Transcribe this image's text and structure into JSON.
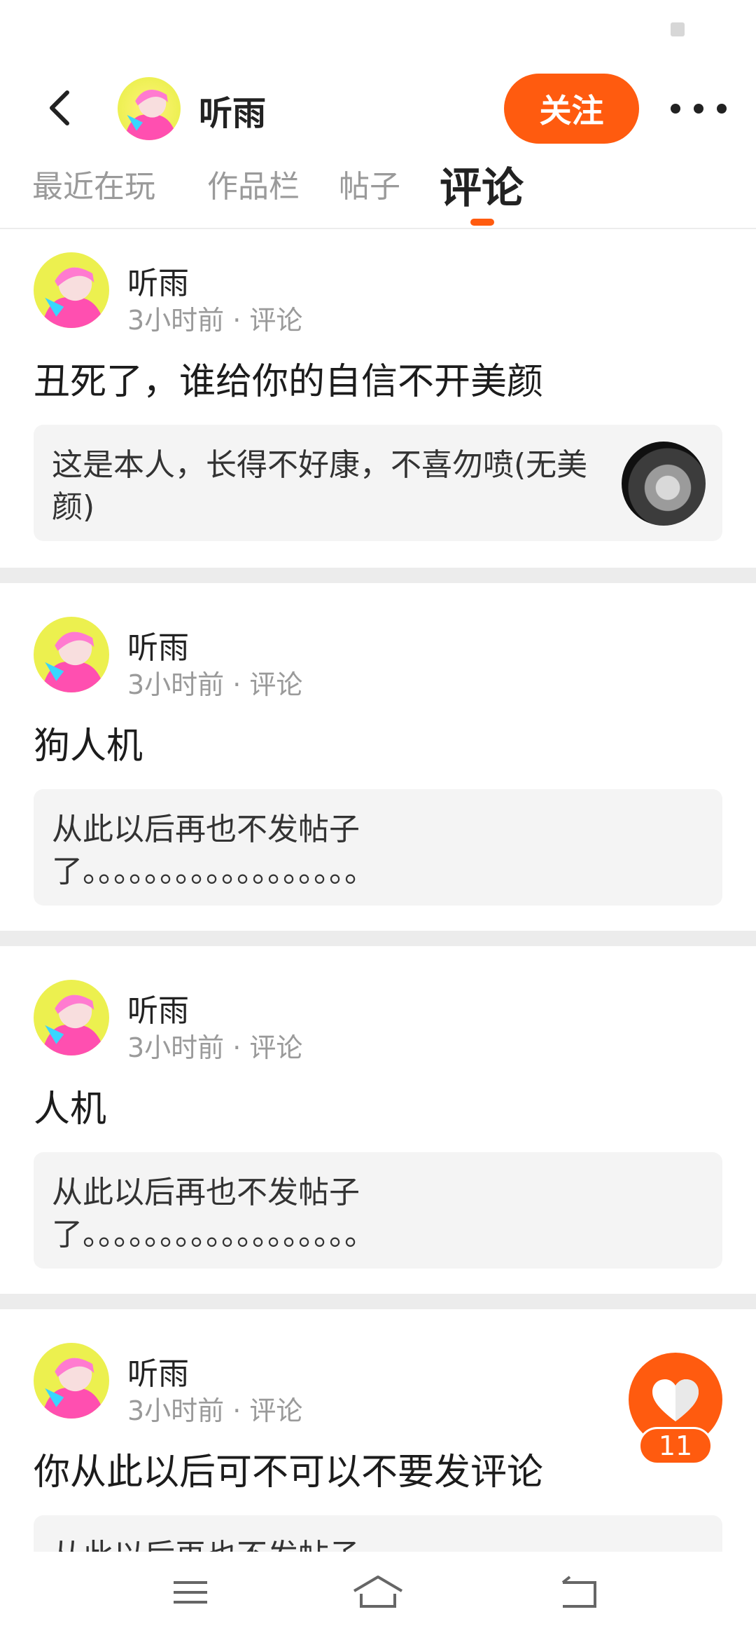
{
  "profile": {
    "name": "听雨"
  },
  "header": {
    "follow_label": "关注"
  },
  "tabs": [
    {
      "label": "最近在玩"
    },
    {
      "label": "作品栏"
    },
    {
      "label": "帖子"
    },
    {
      "label": "评论"
    }
  ],
  "active_tab": "评论",
  "comments": [
    {
      "name": "听雨",
      "meta": "3小时前 · 评论",
      "text": "丑死了，谁给你的自信不开美颜",
      "quote": "这是本人，长得不好康，不喜勿喷(无美颜)"
    },
    {
      "name": "听雨",
      "meta": "3小时前 · 评论",
      "text": "狗人机",
      "quote": "从此以后再也不发帖子了。。。。。。。。。。。。。。。。。。"
    },
    {
      "name": "听雨",
      "meta": "3小时前 · 评论",
      "text": "人机",
      "quote": "从此以后再也不发帖子了。。。。。。。。。。。。。。。。。。"
    },
    {
      "name": "听雨",
      "meta": "3小时前 · 评论",
      "text": "你从此以后可不可以不要发评论",
      "quote": "从此以后再也不发帖子"
    }
  ],
  "like": {
    "count": "11"
  },
  "colors": {
    "accent": "#ff5b0f",
    "divider": "#ececec",
    "quote_bg": "#f4f4f4"
  },
  "icons": {
    "back": "chevron-left-icon",
    "more": "more-dots-icon",
    "like": "heart-icon",
    "nav_menu": "menu-icon",
    "nav_home": "home-icon",
    "nav_back": "back-icon"
  }
}
